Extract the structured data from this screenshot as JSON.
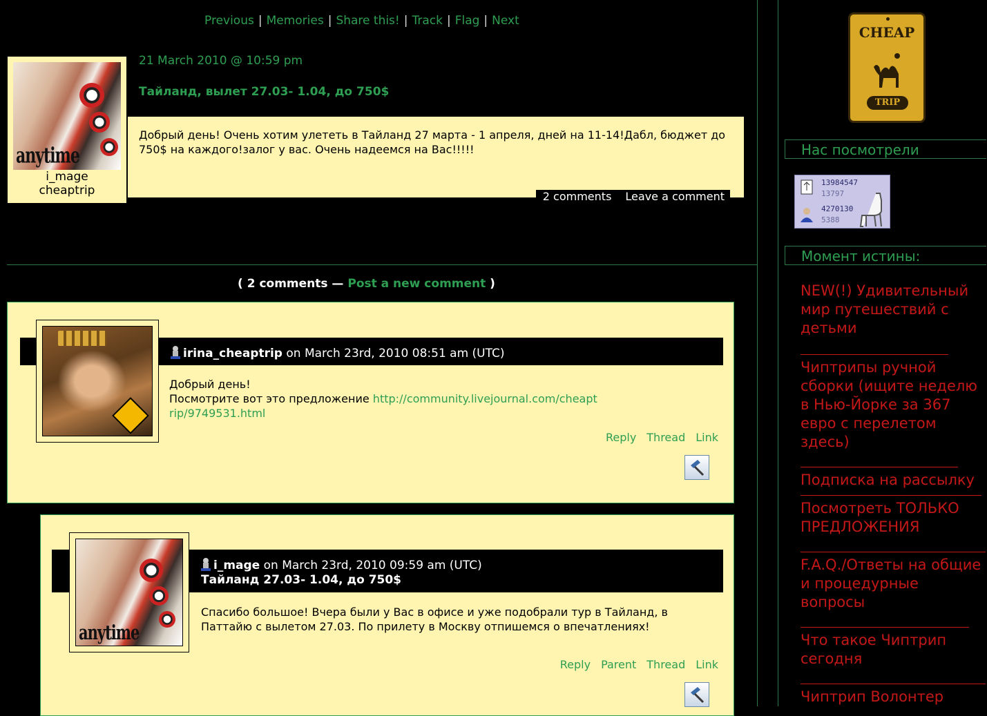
{
  "nav": {
    "previous": "Previous",
    "memories": "Memories",
    "share": "Share this!",
    "track": "Track",
    "flag": "Flag",
    "next": "Next",
    "separator": "|"
  },
  "entry": {
    "userpic_brand": "anytime",
    "username_line1": "i_mage",
    "username_line2": "cheaptrip",
    "date": "21 March 2010 @ 10:59 pm",
    "subject": "Тайланд, вылет 27.03- 1.04, до 750$",
    "body": "Добрый день! Очень хотим улететь в Тайланд 27 марта - 1 апреля, дней на 11-14!Дабл, бюджет до 750$ на каждого!залог у вас. Очень надеемся на Вас!!!!!",
    "comments_link": "2 comments",
    "leave_comment": "Leave a comment"
  },
  "comments_heading": {
    "open": "( ",
    "count": "2 comments",
    "dash": " — ",
    "post_new": "Post a new comment",
    "close": " )"
  },
  "comments": [
    {
      "username": "irina_cheaptrip",
      "meta": " on March 23rd, 2010 08:51 am (UTC)",
      "subject": "",
      "line1": "Добрый день!",
      "line2": "Посмотрите вот это предложение ",
      "link": "http://community.livejournal.com/cheaptrip/9749531.html",
      "link_part1": "http://community.livejournal.com/cheapt",
      "link_part2": "rip/9749531.html",
      "actions": [
        "Reply",
        "Thread",
        "Link"
      ]
    },
    {
      "username": "i_mage",
      "meta": " on March 23rd, 2010 09:59 am (UTC)",
      "subject": "Тайланд 27.03- 1.04, до 750$",
      "body": "Спасибо большое! Вчера были у Вас в офисе и уже подобрали тур в Тайланд, в Паттайю с вылетом 27.03. По прилету в Москву отпишемся о впечатлениях!",
      "userpic_brand": "anytime",
      "actions": [
        "Reply",
        "Parent",
        "Thread",
        "Link"
      ]
    }
  ],
  "sidebar": {
    "logo_top": "CHEAP",
    "logo_bottom": "TRIP",
    "visitors_title": "Нас посмотрели",
    "counter": [
      "13984547",
      "13797",
      "4270130",
      "5388"
    ],
    "moment_title": "Момент истины:",
    "links": [
      "NEW(!) Удивительный мир путешествий с детьми",
      "Чиптрипы ручной сборки (ищите неделю в Нью-Йорке за 367 евро с перелетом здесь)",
      "Подписка на рассылку",
      "Посмотреть ТОЛЬКО ПРЕДЛОЖЕНИЯ",
      "F.A.Q./Ответы на общие и процедурные вопросы",
      "Что такое Чиптрип сегодня",
      "Чиптрип Волонтер"
    ]
  },
  "colors": {
    "background": "#000000",
    "accent_green": "#2e9e52",
    "panel_yellow": "#fff5b0",
    "sidebar_red": "#c41818"
  }
}
